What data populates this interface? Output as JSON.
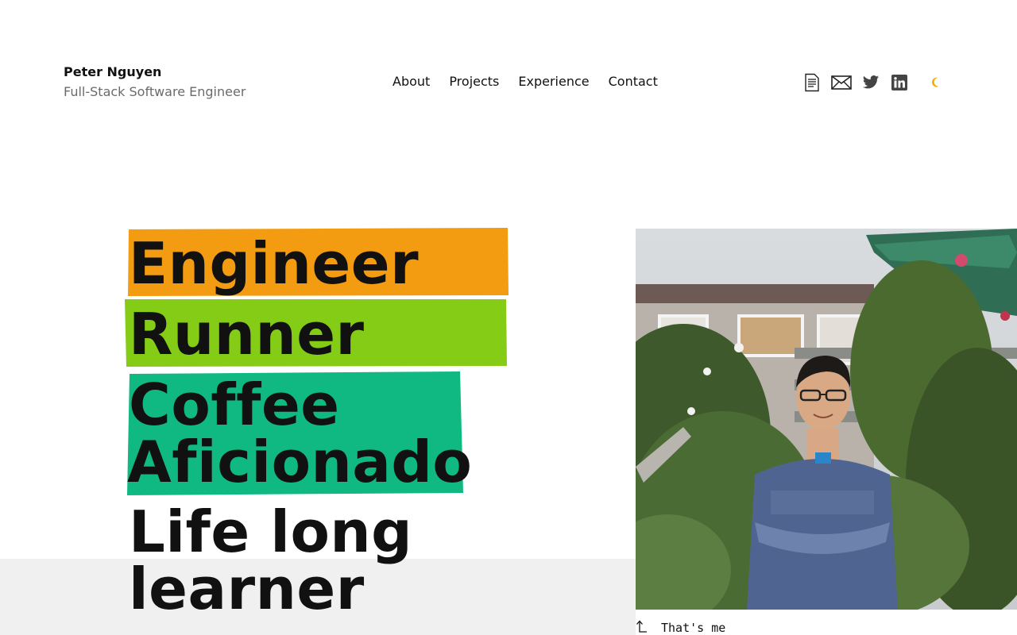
{
  "header": {
    "name": "Peter Nguyen",
    "role": "Full-Stack Software Engineer"
  },
  "nav": {
    "items": [
      {
        "label": "About"
      },
      {
        "label": "Projects"
      },
      {
        "label": "Experience"
      },
      {
        "label": "Contact"
      }
    ]
  },
  "social_icons": [
    "resume-icon",
    "email-icon",
    "twitter-icon",
    "linkedin-icon",
    "moon-icon"
  ],
  "hero": {
    "lines": [
      {
        "text": "Engineer",
        "highlight": "#f39c12"
      },
      {
        "text": "Runner",
        "highlight": "#84cc16"
      },
      {
        "text_line1": "Coffee",
        "text_line2": "Aficionado",
        "highlight": "#10b981"
      },
      {
        "text_line1": "Life long",
        "text_line2": "learner",
        "highlight": "none"
      }
    ]
  },
  "photo": {
    "caption": "That's me"
  },
  "colors": {
    "accent_moon": "#eab308",
    "band": "#f0f0f0",
    "muted_text": "#6b6b6b"
  }
}
